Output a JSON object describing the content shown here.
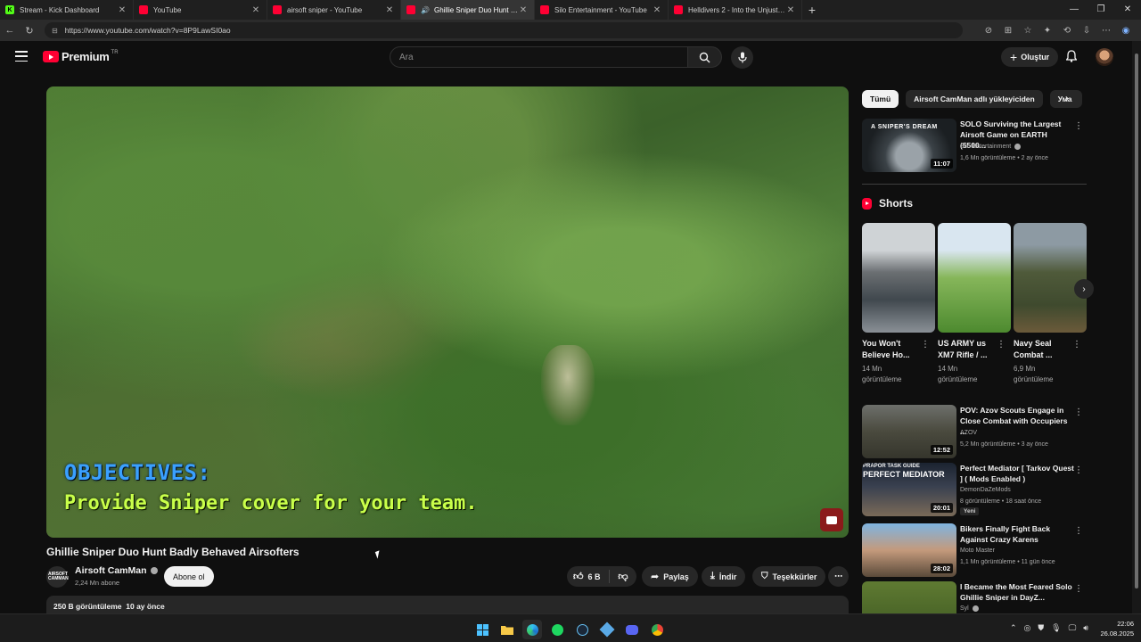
{
  "browser": {
    "tabs": [
      {
        "title": "Stream - Kick Dashboard",
        "fav_color": "#53fc18",
        "fav_letter": "K",
        "active": false
      },
      {
        "title": "YouTube",
        "fav_color": "#ff0033",
        "fav_letter": "",
        "active": false
      },
      {
        "title": "airsoft sniper - YouTube",
        "fav_color": "#ff0033",
        "fav_letter": "",
        "active": false
      },
      {
        "title": "Ghillie Sniper Duo Hunt Badly",
        "fav_color": "#ff0033",
        "fav_letter": "",
        "active": true,
        "audio": true
      },
      {
        "title": "Silo Entertainment - YouTube",
        "fav_color": "#ff0033",
        "fav_letter": "",
        "active": false
      },
      {
        "title": "Helldivers 2 - Into the Unjust Dem",
        "fav_color": "#ff0033",
        "fav_letter": "",
        "active": false
      }
    ],
    "url": "https://www.youtube.com/watch?v=8P9LawSI0ao"
  },
  "header": {
    "logo_text": "Premium",
    "logo_country": "TR",
    "search_placeholder": "Ara",
    "create_label": "Oluştur"
  },
  "video": {
    "overlay_line1": "OBJECTIVES:",
    "overlay_line2": "Provide Sniper cover for your team.",
    "title": "Ghillie Sniper Duo Hunt Badly Behaved Airsofters",
    "channel": "Airsoft CamMan",
    "channel_avatar_text": "AIRSOFT CAMMAN",
    "subscribers": "2,24 Mn abone",
    "subscribe_label": "Abone ol",
    "likes": "6 B",
    "share_label": "Paylaş",
    "download_label": "İndir",
    "thanks_label": "Teşekkürler",
    "views": "250 B görüntüleme",
    "age": "10 ay önce"
  },
  "sidebar": {
    "chips": [
      "Tümü",
      "Airsoft CamMan adlı yükleyiciden",
      "Ума"
    ],
    "top_rec": {
      "title": "SOLO Surviving the Largest Airsoft Game on EARTH (5500...",
      "channel": "Silo Entertainment",
      "meta": "1,6 Mn görüntüleme • 2 ay önce",
      "duration": "11:07",
      "thumb_text": "A SNIPER'S DREAM"
    },
    "shorts_heading": "Shorts",
    "shorts": [
      {
        "title": "You Won't Believe Ho...",
        "views": "14 Mn görüntüleme"
      },
      {
        "title": "US ARMY us XM7 Rifle / ...",
        "views": "14 Mn görüntüleme"
      },
      {
        "title": "Navy Seal Combat ...",
        "views": "6,9 Mn görüntüleme"
      }
    ],
    "recs": [
      {
        "title": "POV: Azov Scouts Engage in Close Combat with Occupiers ...",
        "channel": "AZOV",
        "meta": "5,2 Mn görüntüleme • 3 ay önce",
        "duration": "12:52"
      },
      {
        "title": "Perfect Mediator [ Tarkov Quest ] ( Mods Enabled )",
        "channel": "DemonDaZeMods",
        "meta": "8 görüntüleme • 18 saat önce",
        "duration": "20:01",
        "badge": "Yeni",
        "thumb_text1": "PRAPOR TASK GUIDE",
        "thumb_text2": "PERFECT MEDIATOR"
      },
      {
        "title": "Bikers Finally Fight Back Against Crazy Karens",
        "channel": "Moto Master",
        "meta": "1,1 Mn görüntüleme • 11 gün önce",
        "duration": "28:02"
      },
      {
        "title": "I Became the Most Feared Solo Ghillie Sniper in DayZ...",
        "channel": "Syl",
        "meta": "",
        "duration": ""
      }
    ]
  },
  "taskbar": {
    "time": "22:06",
    "date": "26.08.2025"
  }
}
